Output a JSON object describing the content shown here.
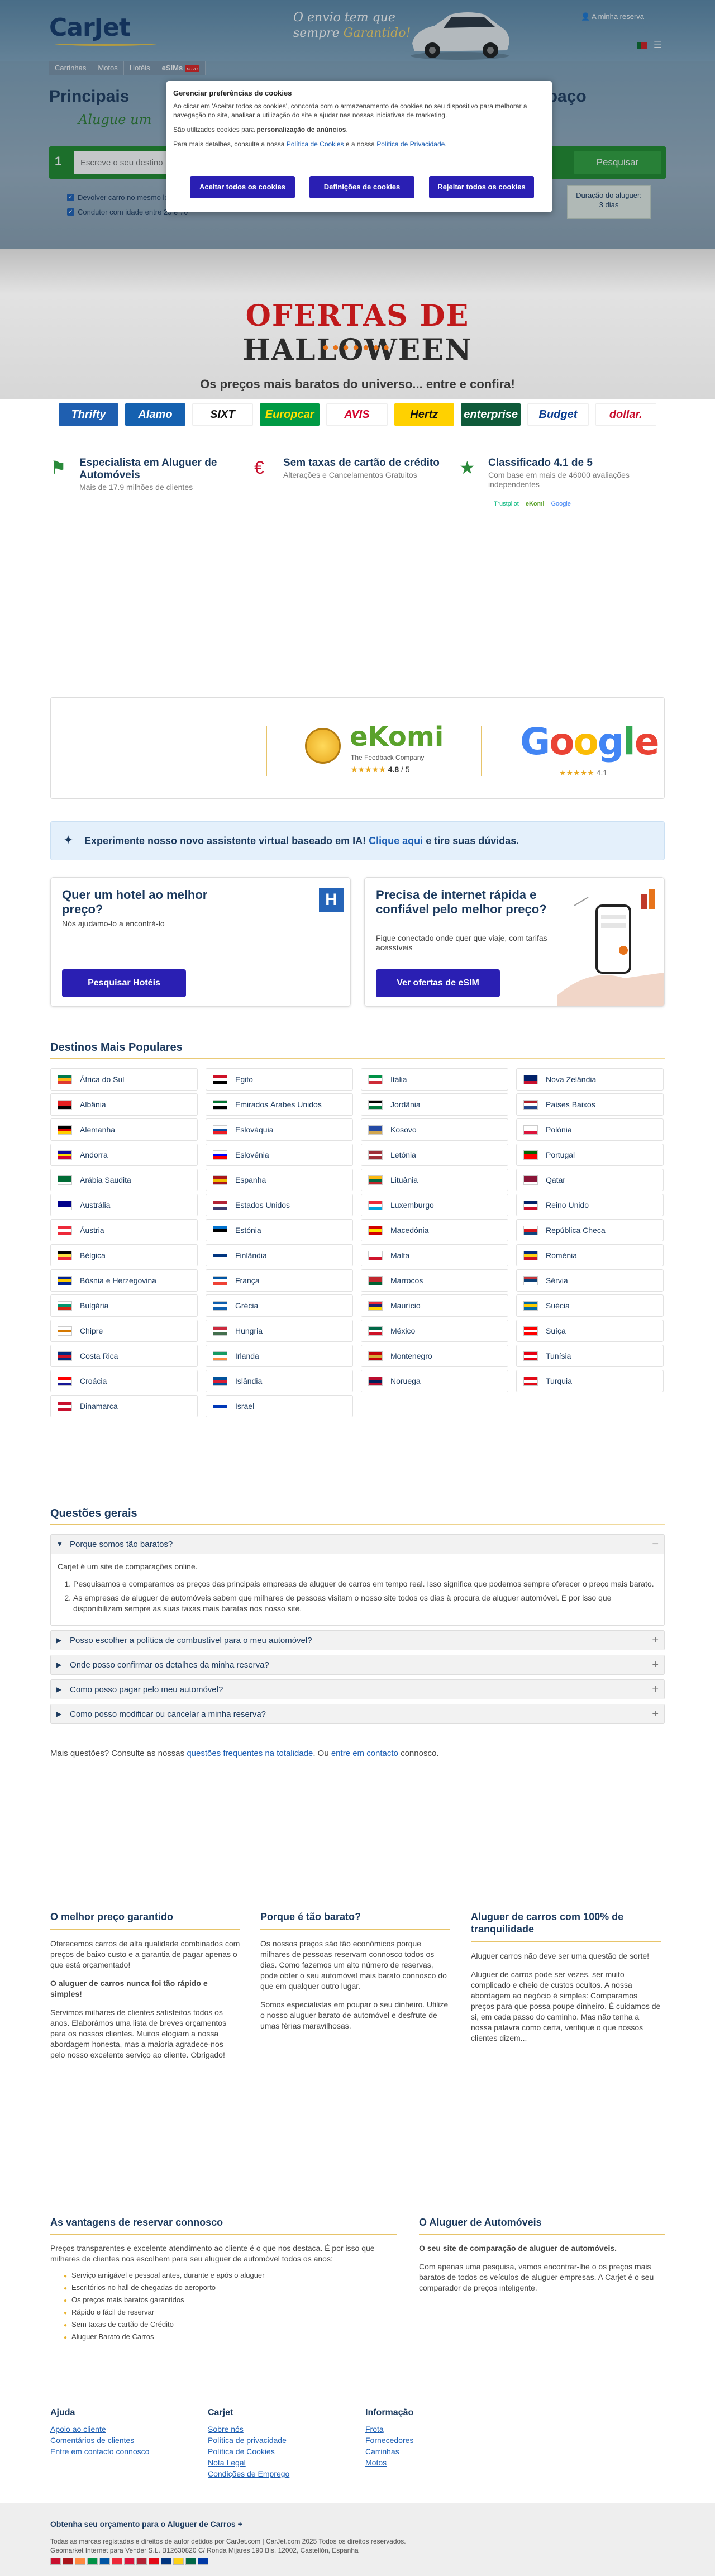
{
  "header": {
    "logo": "CarJet",
    "slogan1": "O envio tem que",
    "slogan2a": "sempre ",
    "slogan2b": "Garantido!",
    "account": "A minha reserva"
  },
  "nav": {
    "tabs": [
      "Carrinhas",
      "Motos",
      "Hotéis",
      "eSIMs"
    ],
    "new_badge": "novo"
  },
  "hero": {
    "title_left": "Principais",
    "title_right": "mo espaço",
    "subtitle": "Alugue um",
    "step": "1",
    "search_placeholder": "Escreve o seu destino",
    "search_button": "Pesquisar",
    "check1": "Devolver carro no mesmo local",
    "check2": "Condutor com idade entre 25 e 70",
    "duration_label": "Duração do aluguer:",
    "duration_value": "3 dias"
  },
  "cookie": {
    "title": "Gerenciar preferências de cookies",
    "p1": "Ao clicar em 'Aceitar todos os cookies', concorda com o armazenamento de cookies no seu dispositivo para melhorar a navegação no site, analisar a utilização do site e ajudar nas nossas iniciativas de marketing.",
    "p2a": "São utilizados cookies para ",
    "p2b": "personalização de anúncios",
    "p2c": ".",
    "p3a": "Para mais detalhes, consulte a nossa ",
    "p3b": "Política de Cookies",
    "p3c": " e a nossa ",
    "p3d": "Política de Privacidade",
    "p3e": ".",
    "accept": "Aceitar todos os cookies",
    "settings": "Definições de cookies",
    "reject": "Rejeitar todos os cookies"
  },
  "halloween": {
    "title_a": "OFERTAS DE ",
    "title_b": "HALLOWEEN",
    "subtitle": "Os preços mais baratos do universo... entre e confira!"
  },
  "brands": [
    {
      "name": "Thrifty",
      "bg": "#1f5fb0",
      "fg": "#fff"
    },
    {
      "name": "Alamo",
      "bg": "#1561b0",
      "fg": "#fff"
    },
    {
      "name": "SIXT",
      "bg": "#fff",
      "fg": "#111"
    },
    {
      "name": "Europcar",
      "bg": "#009a44",
      "fg": "#ffe100"
    },
    {
      "name": "AVIS",
      "bg": "#fff",
      "fg": "#d4002a"
    },
    {
      "name": "Hertz",
      "bg": "#ffd100",
      "fg": "#111"
    },
    {
      "name": "enterprise",
      "bg": "#0f5a3a",
      "fg": "#fff"
    },
    {
      "name": "Budget",
      "bg": "#fff",
      "fg": "#0b3d91"
    },
    {
      "name": "dollar.",
      "bg": "#fff",
      "fg": "#c8102e"
    }
  ],
  "features": [
    {
      "icon": "trophy-icon",
      "title": "Especialista em Aluguer de Automóveis",
      "sub": "Mais de 17.9 milhões de clientes"
    },
    {
      "icon": "no-card-fee-icon",
      "title": "Sem taxas de cartão de crédito",
      "sub": "Alterações e Cancelamentos Gratuitos"
    },
    {
      "icon": "star-rating-icon",
      "title": "Classificado 4.1 de 5",
      "sub": "Com base em mais de 46000 avaliações independentes",
      "logos": [
        "Trustpilot",
        "eKomi",
        "Google"
      ]
    }
  ],
  "ratings": {
    "ekomi_name": "eKomi",
    "ekomi_caption": "The Feedback Company",
    "ekomi_score": "4.8",
    "ekomi_of": " / 5",
    "ekomi_stars": "★★★★★",
    "google_name": "Google",
    "google_stars": "★★★★★",
    "google_score": "4.1"
  },
  "ai": {
    "text_a": "Experimente nosso novo assistente virtual baseado em IA! ",
    "link": "Clique aqui",
    "text_b": " e tire suas dúvidas."
  },
  "cards": {
    "hotel": {
      "title": "Quer um hotel ao melhor preço?",
      "sub": "Nós ajudamo-lo a encontrá-lo",
      "button": "Pesquisar Hotéis",
      "badge": "H"
    },
    "esim": {
      "title": "Precisa de internet rápida e confiável pelo melhor preço?",
      "sub": "Fique conectado onde quer que viaje, com tarifas acessíveis",
      "button": "Ver ofertas de eSIM"
    }
  },
  "destinations": {
    "title": "Destinos Mais Populares",
    "items": [
      {
        "name": "África do Sul",
        "c": [
          "#007a4d",
          "#ffb612",
          "#de3831"
        ]
      },
      {
        "name": "Egito",
        "c": [
          "#ce1126",
          "#fff",
          "#000"
        ]
      },
      {
        "name": "Itália",
        "c": [
          "#009246",
          "#fff",
          "#ce2b37"
        ]
      },
      {
        "name": "Nova Zelândia",
        "c": [
          "#012169",
          "#012169",
          "#c8102e"
        ]
      },
      {
        "name": "Albânia",
        "c": [
          "#e41e20",
          "#e41e20",
          "#000"
        ]
      },
      {
        "name": "Emirados Árabes Unidos",
        "c": [
          "#00732f",
          "#fff",
          "#000"
        ]
      },
      {
        "name": "Jordânia",
        "c": [
          "#000",
          "#fff",
          "#007a3d"
        ]
      },
      {
        "name": "Países Baixos",
        "c": [
          "#ae1c28",
          "#fff",
          "#21468b"
        ]
      },
      {
        "name": "Alemanha",
        "c": [
          "#000",
          "#dd0000",
          "#ffce00"
        ]
      },
      {
        "name": "Eslováquia",
        "c": [
          "#fff",
          "#0b4ea2",
          "#ee1c25"
        ]
      },
      {
        "name": "Kosovo",
        "c": [
          "#244aa5",
          "#244aa5",
          "#d0a650"
        ]
      },
      {
        "name": "Polónia",
        "c": [
          "#fff",
          "#fff",
          "#dc143c"
        ]
      },
      {
        "name": "Andorra",
        "c": [
          "#10069f",
          "#fedd00",
          "#d50032"
        ]
      },
      {
        "name": "Eslovénia",
        "c": [
          "#fff",
          "#0000ff",
          "#ff0000"
        ]
      },
      {
        "name": "Letónia",
        "c": [
          "#9e3039",
          "#fff",
          "#9e3039"
        ]
      },
      {
        "name": "Portugal",
        "c": [
          "#006600",
          "#ff0000",
          "#ff0000"
        ]
      },
      {
        "name": "Arábia Saudita",
        "c": [
          "#006c35",
          "#006c35",
          "#fff"
        ]
      },
      {
        "name": "Espanha",
        "c": [
          "#aa151b",
          "#f1bf00",
          "#aa151b"
        ]
      },
      {
        "name": "Lituânia",
        "c": [
          "#fdb913",
          "#006a44",
          "#c1272d"
        ]
      },
      {
        "name": "Qatar",
        "c": [
          "#8a1538",
          "#8a1538",
          "#fff"
        ]
      },
      {
        "name": "Austrália",
        "c": [
          "#00008b",
          "#00008b",
          "#fff"
        ]
      },
      {
        "name": "Estados Unidos",
        "c": [
          "#b22234",
          "#fff",
          "#3c3b6e"
        ]
      },
      {
        "name": "Luxemburgo",
        "c": [
          "#ed2939",
          "#fff",
          "#00a1de"
        ]
      },
      {
        "name": "Reino Unido",
        "c": [
          "#012169",
          "#fff",
          "#c8102e"
        ]
      },
      {
        "name": "Áustria",
        "c": [
          "#ed2939",
          "#fff",
          "#ed2939"
        ]
      },
      {
        "name": "Estónia",
        "c": [
          "#0072ce",
          "#000",
          "#fff"
        ]
      },
      {
        "name": "Macedónia",
        "c": [
          "#d20000",
          "#ffe600",
          "#d20000"
        ]
      },
      {
        "name": "República Checa",
        "c": [
          "#fff",
          "#d7141a",
          "#11457e"
        ]
      },
      {
        "name": "Bélgica",
        "c": [
          "#000",
          "#fae042",
          "#ed2939"
        ]
      },
      {
        "name": "Finlândia",
        "c": [
          "#fff",
          "#003580",
          "#fff"
        ]
      },
      {
        "name": "Malta",
        "c": [
          "#fff",
          "#fff",
          "#cf142b"
        ]
      },
      {
        "name": "Roménia",
        "c": [
          "#002b7f",
          "#fcd116",
          "#ce1126"
        ]
      },
      {
        "name": "Bósnia e Herzegovina",
        "c": [
          "#002395",
          "#fecb00",
          "#002395"
        ]
      },
      {
        "name": "França",
        "c": [
          "#0055a4",
          "#fff",
          "#ef4135"
        ]
      },
      {
        "name": "Marrocos",
        "c": [
          "#c1272d",
          "#c1272d",
          "#006233"
        ]
      },
      {
        "name": "Sérvia",
        "c": [
          "#c6363c",
          "#0c4076",
          "#fff"
        ]
      },
      {
        "name": "Bulgária",
        "c": [
          "#fff",
          "#00966e",
          "#d62612"
        ]
      },
      {
        "name": "Grécia",
        "c": [
          "#0d5eaf",
          "#fff",
          "#0d5eaf"
        ]
      },
      {
        "name": "Maurício",
        "c": [
          "#ea2839",
          "#1a206d",
          "#ffd500"
        ]
      },
      {
        "name": "Suécia",
        "c": [
          "#006aa7",
          "#fecc00",
          "#006aa7"
        ]
      },
      {
        "name": "Chipre",
        "c": [
          "#fff",
          "#d57800",
          "#fff"
        ]
      },
      {
        "name": "Hungria",
        "c": [
          "#cd2a3e",
          "#fff",
          "#436f4d"
        ]
      },
      {
        "name": "México",
        "c": [
          "#006847",
          "#fff",
          "#ce1126"
        ]
      },
      {
        "name": "Suíça",
        "c": [
          "#ff0000",
          "#fff",
          "#ff0000"
        ]
      },
      {
        "name": "Costa Rica",
        "c": [
          "#002b7f",
          "#ce1126",
          "#002b7f"
        ]
      },
      {
        "name": "Irlanda",
        "c": [
          "#169b62",
          "#fff",
          "#ff883e"
        ]
      },
      {
        "name": "Montenegro",
        "c": [
          "#c40308",
          "#d4af3a",
          "#c40308"
        ]
      },
      {
        "name": "Tunísia",
        "c": [
          "#e70013",
          "#fff",
          "#e70013"
        ]
      },
      {
        "name": "Croácia",
        "c": [
          "#ff0000",
          "#fff",
          "#171796"
        ]
      },
      {
        "name": "Islândia",
        "c": [
          "#02529c",
          "#dc1e35",
          "#02529c"
        ]
      },
      {
        "name": "Noruega",
        "c": [
          "#ba0c2f",
          "#00205b",
          "#ba0c2f"
        ]
      },
      {
        "name": "Turquia",
        "c": [
          "#e30a17",
          "#fff",
          "#e30a17"
        ]
      },
      {
        "name": "Dinamarca",
        "c": [
          "#c8102e",
          "#fff",
          "#c8102e"
        ]
      },
      {
        "name": "Israel",
        "c": [
          "#fff",
          "#0038b8",
          "#fff"
        ]
      }
    ]
  },
  "faq": {
    "title": "Questões gerais",
    "items": [
      {
        "q": "Porque somos tão baratos?",
        "open": true,
        "a": "Carjet é um site de comparações online.",
        "li": [
          "Pesquisamos e comparamos os preços das principais empresas de aluguer de carros em tempo real. Isso significa que podemos sempre oferecer o preço mais barato.",
          "As empresas de aluguer de automóveis sabem que milhares de pessoas visitam o nosso site todos os dias à procura de aluguer automóvel. É por isso que disponibilizam sempre as suas taxas mais baratas nos nosso site."
        ]
      },
      {
        "q": "Posso escolher a política de combustível para o meu automóvel?",
        "open": false
      },
      {
        "q": "Onde posso confirmar os detalhes da minha reserva?",
        "open": false
      },
      {
        "q": "Como posso pagar pelo meu automóvel?",
        "open": false
      },
      {
        "q": "Como posso modificar ou cancelar a minha reserva?",
        "open": false
      }
    ],
    "more_a": "Mais questões? Consulte as nossas ",
    "more_link1": "questões frequentes na totalidade",
    "more_b": ". Ou ",
    "more_link2": "entre em contacto",
    "more_c": " connosco."
  },
  "columns": [
    {
      "title": "O melhor preço garantido",
      "p": [
        "Oferecemos carros de alta qualidade combinados com preços de baixo custo e a garantia de pagar apenas o que está orçamentado!",
        "O aluguer de carros nunca foi tão rápido e simples!",
        "Servimos milhares de clientes satisfeitos todos os anos. Elaborámos uma lista de breves orçamentos para os nossos clientes. Muitos elogiam a nossa abordagem honesta, mas a maioria agradece-nos pelo nosso excelente serviço ao cliente. Obrigado!"
      ]
    },
    {
      "title": "Porque é tão barato?",
      "p": [
        "Os nossos preços são tão económicos porque milhares de pessoas reservam connosco todos os dias. Como fazemos um alto número de reservas, pode obter o seu automóvel mais barato connosco do que em qualquer outro lugar.",
        "Somos especialistas em poupar o seu dinheiro. Utilize o nosso aluguer barato de automóvel e desfrute de umas férias maravilhosas."
      ]
    },
    {
      "title": "Aluguer de carros com 100% de tranquilidade",
      "p": [
        "Aluguer carros não deve ser uma questão de sorte!",
        "Aluguer de carros pode ser vezes, ser muito complicado e cheio de custos ocultos. A nossa abordagem ao negócio é simples: Comparamos preços para que possa poupe dinheiro. É cuidamos de si, em cada passo do caminho. Mas não tenha a nossa palavra como certa, verifique o que nossos clientes dizem..."
      ]
    }
  ],
  "advantages": {
    "title": "As vantagens de reservar connosco",
    "p": "Preços transparentes e excelente atendimento ao cliente é o que nos destaca. É por isso que milhares de clientes nos escolhem para seu aluguer de automóvel todos os anos:",
    "items": [
      "Serviço amigável e pessoal antes, durante e após o aluguer",
      "Escritórios no hall de chegadas do aeroporto",
      "Os preços mais baratos garantidos",
      "Rápido e fácil de reservar",
      "Sem taxas de cartão de Crédito",
      "Aluguer Barato de Carros"
    ]
  },
  "about": {
    "title": "O Aluguer de Automóveis",
    "p1": "O seu site de comparação de aluguer de automóveis.",
    "p2": "Com apenas uma pesquisa, vamos encontrar-lhe o os preços mais baratos de todos os veículos de aluguer empresas. A Carjet é o seu comparador de preços inteligente."
  },
  "footer": {
    "cols": [
      {
        "title": "Ajuda",
        "links": [
          "Apoio ao cliente",
          "Comentários de clientes",
          "Entre em contacto connosco"
        ]
      },
      {
        "title": "Carjet",
        "links": [
          "Sobre nós",
          "Política de privacidade",
          "Política de Cookies",
          "Nota Legal",
          "Condições de Emprego"
        ]
      },
      {
        "title": "Informação",
        "links": [
          "Frota",
          "Fornecedores",
          "Carrinhas",
          "Motos"
        ]
      }
    ],
    "quote": "Obtenha seu orçamento para o Aluguer de Carros",
    "copy1": "Todas as marcas registadas e direitos de autor detidos por CarJet.com | CarJet.com 2025 Todos os direitos reservados.",
    "copy2": "Geomarket Internet para Vender S.L. B12630820 C/ Ronda Mijares 190 Bis, 12002, Castellón, Espanha",
    "flags": [
      "#c8102e",
      "#aa151b",
      "#ff883e",
      "#009246",
      "#0055a4",
      "#ed2939",
      "#dc143c",
      "#b22234",
      "#e30a17",
      "#003580",
      "#fcd116",
      "#006847",
      "#0039a6"
    ]
  }
}
